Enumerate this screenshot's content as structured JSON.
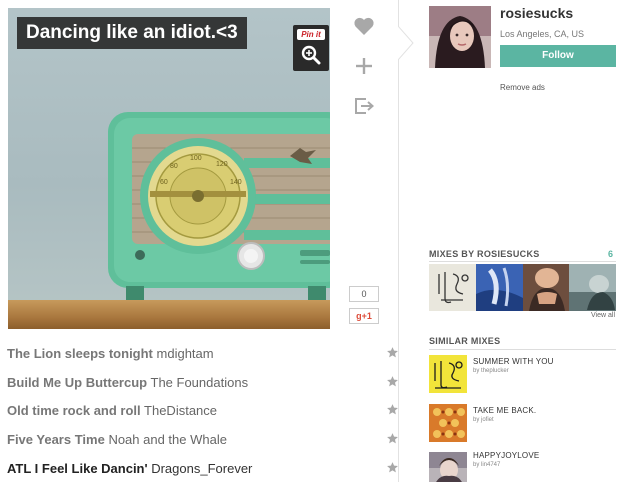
{
  "mix": {
    "title": "Dancing like an idiot.<3",
    "pin_label": "Pin it"
  },
  "share": {
    "count_0": "0",
    "gplus_label": "g+1"
  },
  "profile": {
    "username": "rosiesucks",
    "location": "Los Angeles, CA, US",
    "follow_label": "Follow",
    "remove_ads": "Remove ads"
  },
  "mixes_by": {
    "heading": "MIXES BY ROSIESUCKS",
    "count": "6",
    "view_all": "View all"
  },
  "similar": {
    "heading": "SIMILAR MIXES",
    "items": [
      {
        "title": "SUMMER WITH YOU",
        "by": "by theplucker"
      },
      {
        "title": "TAKE ME BACK.",
        "by": "by jofiet"
      },
      {
        "title": "HAPPYJOYLOVE",
        "by": "by lin4747"
      }
    ]
  },
  "tracks": [
    {
      "title": "The Lion sleeps tonight",
      "artist": "mdightam"
    },
    {
      "title": "Build Me Up Buttercup",
      "artist": "The Foundations"
    },
    {
      "title": "Old time rock and roll",
      "artist": "TheDistance"
    },
    {
      "title": "Five Years Time",
      "artist": "Noah and the Whale"
    },
    {
      "title": "ATL I Feel Like Dancin'",
      "artist": "Dragons_Forever"
    }
  ],
  "colors": {
    "accent": "#5bb5a2",
    "radio_body": "#5fbf9a",
    "pin_red": "#cb2027"
  }
}
